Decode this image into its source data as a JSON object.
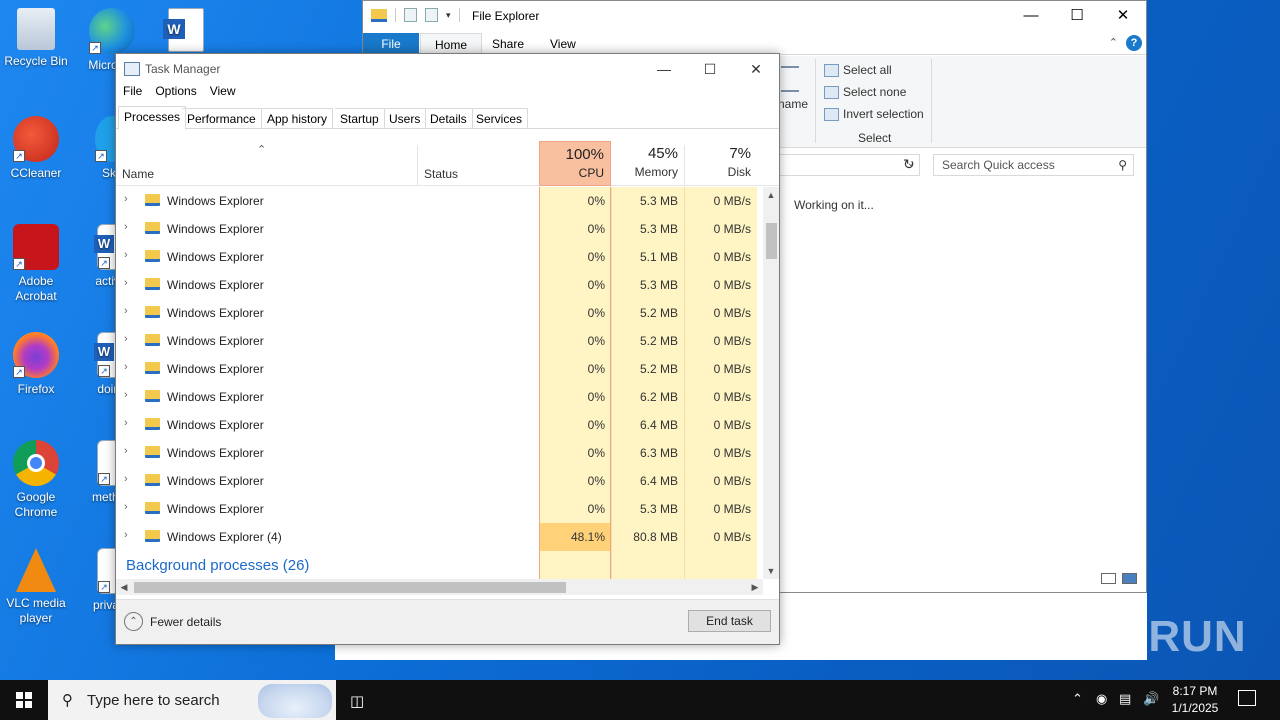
{
  "desktop": {
    "icons": [
      {
        "label": "Recycle Bin",
        "icon": "recycle-bin-icon"
      },
      {
        "label": "Micro Ed",
        "icon": "edge-icon"
      },
      {
        "label": "CCleaner",
        "icon": "ccleaner-icon"
      },
      {
        "label": "Sky",
        "icon": "skype-icon"
      },
      {
        "label": "Adobe Acrobat",
        "icon": "acrobat-icon"
      },
      {
        "label": "activiti",
        "icon": "word-doc-icon"
      },
      {
        "label": "Firefox",
        "icon": "firefox-icon"
      },
      {
        "label": "doing",
        "icon": "word-doc-icon"
      },
      {
        "label": "Google Chrome",
        "icon": "chrome-icon"
      },
      {
        "label": "method",
        "icon": "image-file-icon"
      },
      {
        "label": "VLC media player",
        "icon": "vlc-icon"
      },
      {
        "label": "privacy",
        "icon": "image-file-icon"
      }
    ]
  },
  "file_explorer": {
    "title": "File Explorer",
    "tabs": {
      "file": "File",
      "home": "Home",
      "share": "Share",
      "view": "View"
    },
    "ribbon": {
      "rename_partial": "name",
      "select_all": "Select all",
      "select_none": "Select none",
      "invert_selection": "Invert selection",
      "group_label": "Select"
    },
    "search_placeholder": "Search Quick access",
    "status_text": "Working on it..."
  },
  "task_manager": {
    "title": "Task Manager",
    "menu": [
      "File",
      "Options",
      "View"
    ],
    "tabs": [
      "Processes",
      "Performance",
      "App history",
      "Startup",
      "Users",
      "Details",
      "Services"
    ],
    "active_tab": "Processes",
    "columns": {
      "name": "Name",
      "status": "Status",
      "cpu": {
        "pct": "100%",
        "label": "CPU"
      },
      "memory": {
        "pct": "45%",
        "label": "Memory"
      },
      "disk": {
        "pct": "7%",
        "label": "Disk"
      }
    },
    "rows": [
      {
        "name": "Windows Explorer",
        "cpu": "0%",
        "memory": "5.3 MB",
        "disk": "0 MB/s"
      },
      {
        "name": "Windows Explorer",
        "cpu": "0%",
        "memory": "5.3 MB",
        "disk": "0 MB/s"
      },
      {
        "name": "Windows Explorer",
        "cpu": "0%",
        "memory": "5.1 MB",
        "disk": "0 MB/s"
      },
      {
        "name": "Windows Explorer",
        "cpu": "0%",
        "memory": "5.3 MB",
        "disk": "0 MB/s"
      },
      {
        "name": "Windows Explorer",
        "cpu": "0%",
        "memory": "5.2 MB",
        "disk": "0 MB/s"
      },
      {
        "name": "Windows Explorer",
        "cpu": "0%",
        "memory": "5.2 MB",
        "disk": "0 MB/s"
      },
      {
        "name": "Windows Explorer",
        "cpu": "0%",
        "memory": "5.2 MB",
        "disk": "0 MB/s"
      },
      {
        "name": "Windows Explorer",
        "cpu": "0%",
        "memory": "6.2 MB",
        "disk": "0 MB/s"
      },
      {
        "name": "Windows Explorer",
        "cpu": "0%",
        "memory": "6.4 MB",
        "disk": "0 MB/s"
      },
      {
        "name": "Windows Explorer",
        "cpu": "0%",
        "memory": "6.3 MB",
        "disk": "0 MB/s"
      },
      {
        "name": "Windows Explorer",
        "cpu": "0%",
        "memory": "6.4 MB",
        "disk": "0 MB/s"
      },
      {
        "name": "Windows Explorer",
        "cpu": "0%",
        "memory": "5.3 MB",
        "disk": "0 MB/s"
      },
      {
        "name": "Windows Explorer (4)",
        "cpu": "48.1%",
        "memory": "80.8 MB",
        "disk": "0 MB/s"
      }
    ],
    "group_title": "Background processes (26)",
    "fewer_details": "Fewer details",
    "end_task": "End task"
  },
  "taskbar": {
    "search_placeholder": "Type here to search",
    "time": "8:17 PM",
    "date": "1/1/2025"
  },
  "watermark": "ANY RUN",
  "colors": {
    "cpu_header": "#f9c0a0",
    "cpu_hot": "#ffd27a",
    "column_fill": "#fff4c4",
    "link_blue": "#1b6ac9",
    "file_tab": "#1979ca"
  }
}
